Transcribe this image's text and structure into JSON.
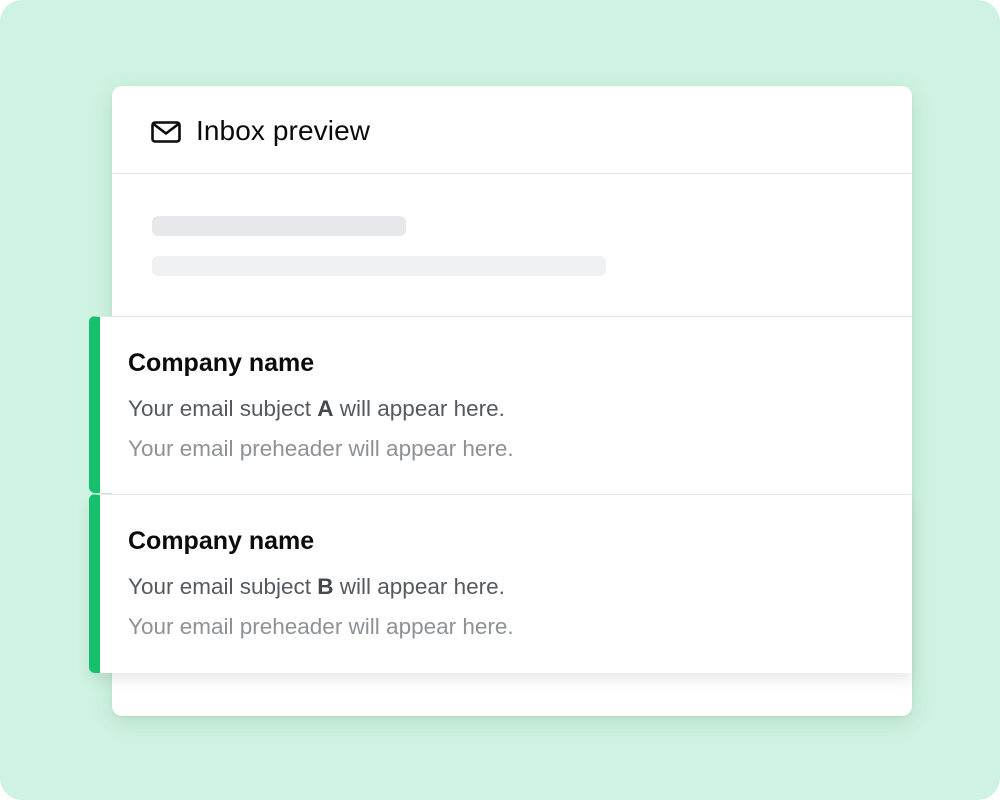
{
  "header": {
    "icon": "mail-icon",
    "title": "Inbox preview"
  },
  "colors": {
    "background": "#cff3e2",
    "accent": "#16bf6c"
  },
  "emails": [
    {
      "company": "Company name",
      "subject_before": "Your email subject ",
      "variant": "A",
      "subject_after": " will appear here.",
      "preheader": "Your email preheader will appear here."
    },
    {
      "company": "Company name",
      "subject_before": "Your email subject ",
      "variant": "B",
      "subject_after": " will appear here.",
      "preheader": "Your email preheader will appear here."
    }
  ]
}
